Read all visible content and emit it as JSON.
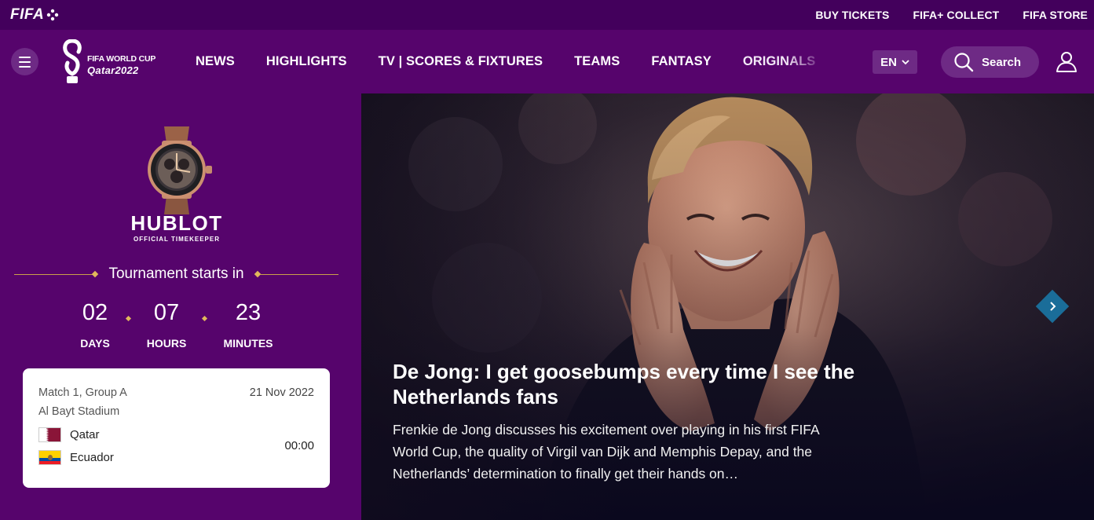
{
  "topbar": {
    "logo_text": "FIFA",
    "links": [
      "BUY TICKETS",
      "FIFA+ COLLECT",
      "FIFA STORE"
    ]
  },
  "nav": {
    "brand_line1": "FIFA WORLD CUP",
    "brand_line2": "Qatar2022",
    "items": [
      "NEWS",
      "HIGHLIGHTS",
      "TV | SCORES & FIXTURES",
      "TEAMS",
      "FANTASY",
      "ORIGINALS"
    ],
    "language": "EN",
    "search_label": "Search"
  },
  "sponsor": {
    "name": "HUBLOT",
    "tagline": "OFFICIAL TIMEKEEPER"
  },
  "countdown": {
    "heading": "Tournament starts in",
    "days": "02",
    "days_label": "DAYS",
    "hours": "07",
    "hours_label": "HOURS",
    "minutes": "23",
    "minutes_label": "MINUTES"
  },
  "match": {
    "title": "Match 1, Group A",
    "date": "21 Nov 2022",
    "venue": "Al Bayt Stadium",
    "home_team": "Qatar",
    "away_team": "Ecuador",
    "time": "00:00"
  },
  "hero": {
    "headline": "De Jong: I get goosebumps every time I see the Netherlands fans",
    "summary": "Frenkie de Jong discusses his excitement over playing in his first FIFA World Cup, the quality of Virgil van Dijk and Memphis Depay, and the Netherlands’ determination to finally get their hands on…"
  },
  "colors": {
    "brand_purple": "#56046c",
    "topbar_purple": "#43005c",
    "accent_gold": "#e1b85b",
    "carousel_button": "#1a6d99"
  },
  "icons": [
    "fifa-plus-icon",
    "menu-icon",
    "world-cup-emblem",
    "chevron-down-icon",
    "search-icon",
    "user-icon",
    "chevron-right-icon",
    "qatar-flag",
    "ecuador-flag"
  ]
}
